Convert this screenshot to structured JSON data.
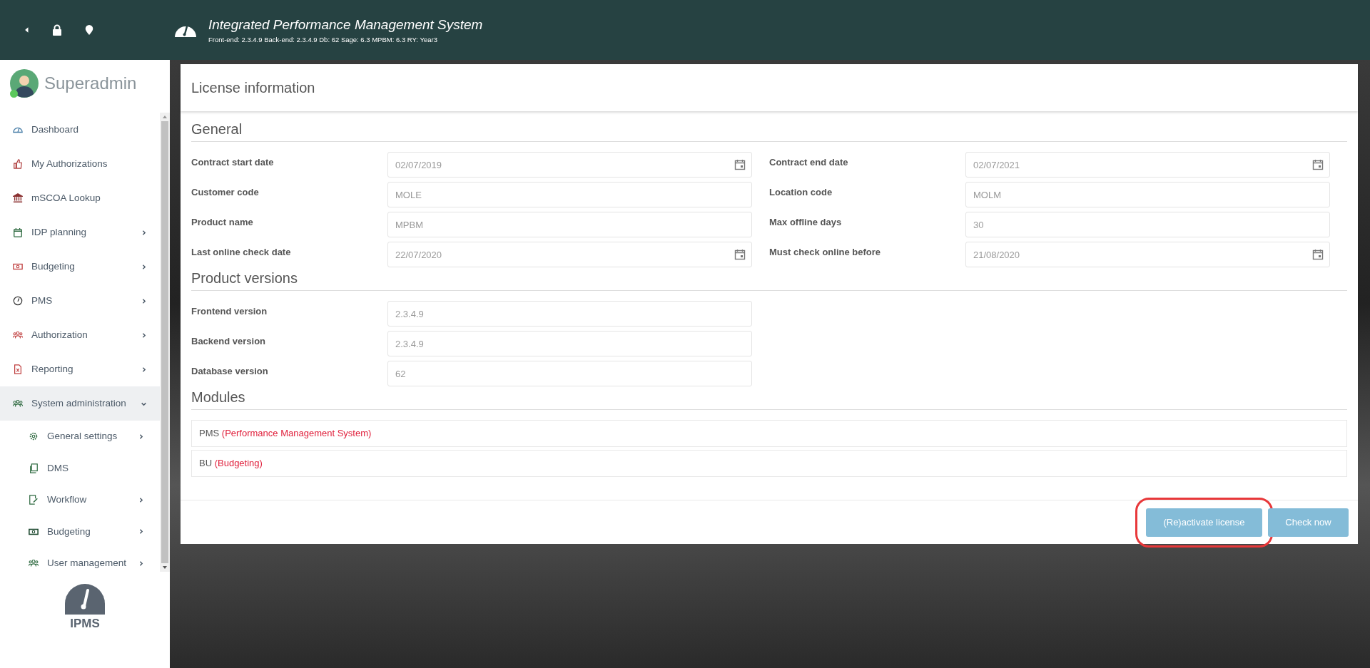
{
  "header": {
    "title": "Integrated Performance Management System",
    "subtitle": "Front-end: 2.3.4.9 Back-end: 2.3.4.9 Db: 62 Sage: 6.3 MPBM: 6.3 RY: Year3"
  },
  "user": {
    "name": "Superadmin",
    "online": true
  },
  "sidebar": {
    "items": [
      {
        "label": "Dashboard",
        "expandable": false,
        "selected": false
      },
      {
        "label": "My Authorizations",
        "expandable": false,
        "selected": false
      },
      {
        "label": "mSCOA Lookup",
        "expandable": false,
        "selected": false
      },
      {
        "label": "IDP planning",
        "expandable": true,
        "expanded": false,
        "selected": false
      },
      {
        "label": "Budgeting",
        "expandable": true,
        "expanded": false,
        "selected": false
      },
      {
        "label": "PMS",
        "expandable": true,
        "expanded": false,
        "selected": false
      },
      {
        "label": "Authorization",
        "expandable": true,
        "expanded": false,
        "selected": false
      },
      {
        "label": "Reporting",
        "expandable": true,
        "expanded": false,
        "selected": false
      },
      {
        "label": "System administration",
        "expandable": true,
        "expanded": true,
        "selected": true,
        "children": [
          {
            "label": "General settings",
            "expandable": true
          },
          {
            "label": "DMS",
            "expandable": false
          },
          {
            "label": "Workflow",
            "expandable": true
          },
          {
            "label": "Budgeting",
            "expandable": true
          },
          {
            "label": "User management",
            "expandable": true
          }
        ]
      }
    ],
    "logo": "IPMS"
  },
  "card": {
    "title": "License information",
    "sections": [
      {
        "title": "General",
        "fields": [
          {
            "label": "Contract start date",
            "value": "02/07/2019",
            "kind": "date"
          },
          {
            "label": "Contract end date",
            "value": "02/07/2021",
            "kind": "date"
          },
          {
            "label": "Customer code",
            "value": "MOLE",
            "kind": "text"
          },
          {
            "label": "Location code",
            "value": "MOLM",
            "kind": "text"
          },
          {
            "label": "Product name",
            "value": "MPBM",
            "kind": "text"
          },
          {
            "label": "Max offline days",
            "value": "30",
            "kind": "text"
          },
          {
            "label": "Last online check date",
            "value": "22/07/2020",
            "kind": "date"
          },
          {
            "label": "Must check online before",
            "value": "21/08/2020",
            "kind": "date"
          }
        ]
      },
      {
        "title": "Product versions",
        "fields": [
          {
            "label": "Frontend version",
            "value": "2.3.4.9",
            "kind": "text"
          },
          {
            "label": "Backend version",
            "value": "2.3.4.9",
            "kind": "text"
          },
          {
            "label": "Database version",
            "value": "62",
            "kind": "text"
          }
        ]
      }
    ],
    "modules_title": "Modules",
    "modules": [
      {
        "code": "PMS",
        "name": "(Performance Management System)"
      },
      {
        "code": "BU",
        "name": "(Budgeting)"
      }
    ],
    "buttons": [
      {
        "label": "(Re)activate license",
        "highlighted": true
      },
      {
        "label": "Check now",
        "highlighted": false
      }
    ]
  }
}
